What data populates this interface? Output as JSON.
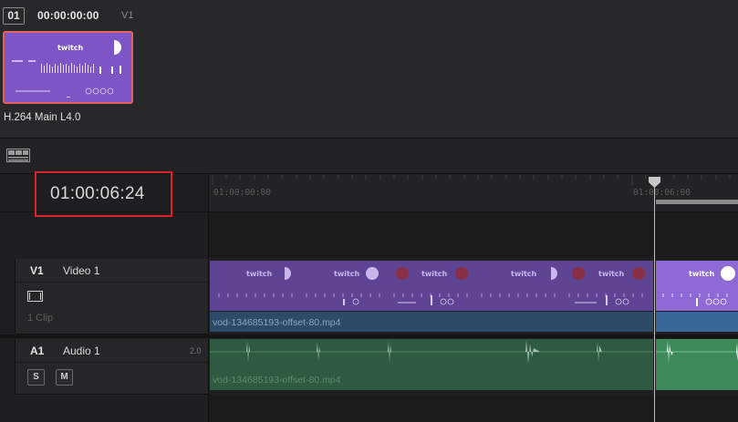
{
  "clip_panel": {
    "index": "01",
    "timecode": "00:00:00:00",
    "track": "V1",
    "clip_name": "H.264 Main L4.0",
    "thumbnail_logo": "twitch"
  },
  "timecode_display": {
    "value": "01:00:06:24",
    "highlight_color": "#d8232a"
  },
  "ruler": {
    "labels": [
      "01:00:00:00",
      "01:00:06:00"
    ]
  },
  "tracks": {
    "video": {
      "id": "V1",
      "name": "Video 1",
      "clip_count": "1 Clip",
      "clip_file": "vod-134685193-offset-80.mp4",
      "clip_color": "#6a49a0",
      "thumbnail_logo": "twitch"
    },
    "audio": {
      "id": "A1",
      "name": "Audio 1",
      "level": "2.0",
      "solo_label": "S",
      "mute_label": "M",
      "clip_file": "vod-134685193-offset-80.mp4",
      "clip_color": "#2d5a40"
    }
  },
  "icons": [
    "timeline-view-icon",
    "monitor-icon",
    "playhead-icon"
  ]
}
